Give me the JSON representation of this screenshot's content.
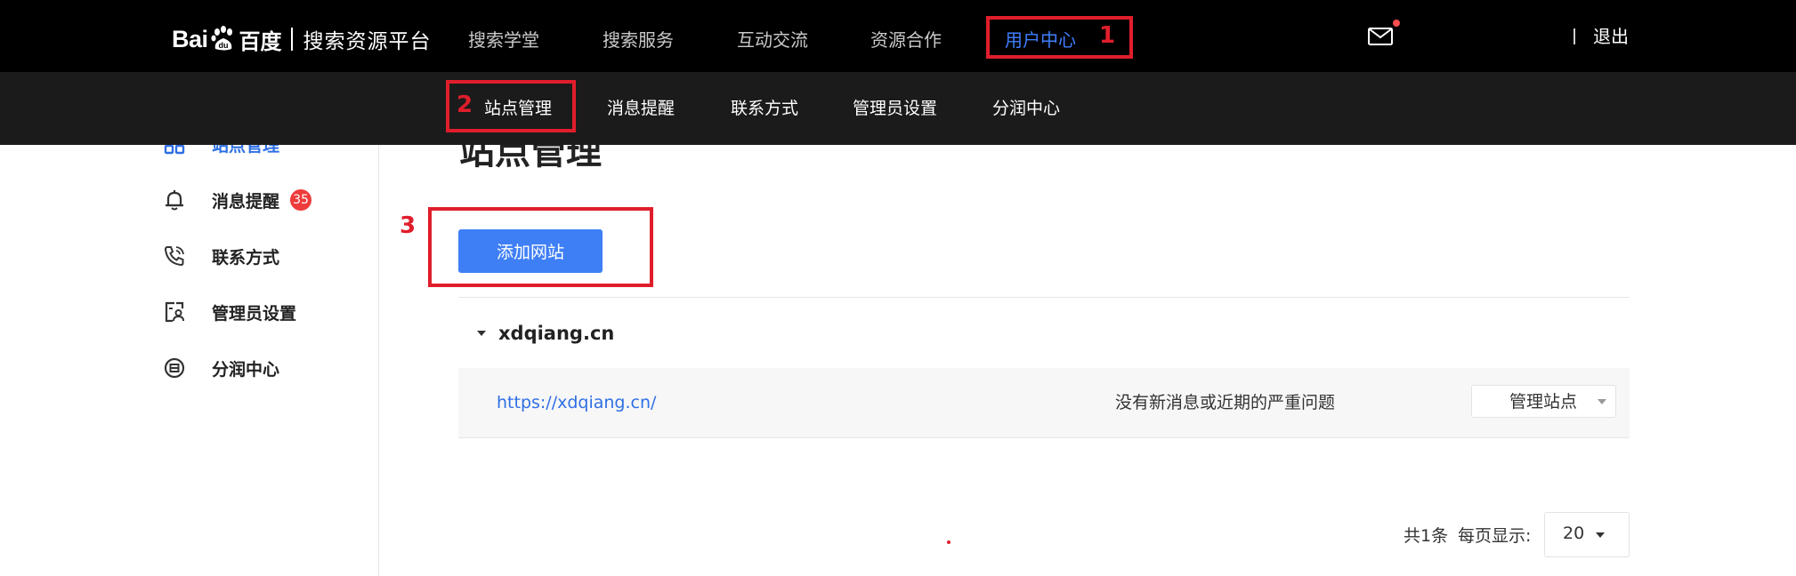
{
  "brand": {
    "logo_text": "Bai",
    "logo_mark_text": "du",
    "logo_cn": "百度",
    "platform": "搜索资源平台"
  },
  "topnav": {
    "items": [
      {
        "label": "搜索学堂"
      },
      {
        "label": "搜索服务"
      },
      {
        "label": "互动交流"
      },
      {
        "label": "资源合作"
      },
      {
        "label": "用户中心",
        "active": true
      }
    ],
    "logout_label": "退出",
    "mail_icon": "mail-icon"
  },
  "subnav": {
    "items": [
      {
        "label": "站点管理",
        "active": true
      },
      {
        "label": "消息提醒"
      },
      {
        "label": "联系方式"
      },
      {
        "label": "管理员设置"
      },
      {
        "label": "分润中心"
      }
    ]
  },
  "annotations": {
    "numbers": [
      "1",
      "2",
      "3"
    ],
    "color": "#e01e2b"
  },
  "sidebar": {
    "items": [
      {
        "label": "站点管理",
        "icon": "site-grid-icon",
        "active": true
      },
      {
        "label": "消息提醒",
        "icon": "bell-icon",
        "badge": "35"
      },
      {
        "label": "联系方式",
        "icon": "phone-icon"
      },
      {
        "label": "管理员设置",
        "icon": "admin-card-icon"
      },
      {
        "label": "分润中心",
        "icon": "coin-icon"
      }
    ]
  },
  "main": {
    "title": "站点管理",
    "add_button": "添加网站",
    "site": {
      "name": "xdqiang.cn",
      "url": "https://xdqiang.cn/",
      "status": "没有新消息或近期的严重问题",
      "manage_label": "管理站点"
    },
    "pager": {
      "total": "共1条",
      "per_page_label": "每页显示:",
      "per_page_value": "20"
    }
  },
  "colors": {
    "accent": "#3f7ff6",
    "link": "#2f6fe4",
    "badge": "#ee3b3b",
    "topbar": "#000000",
    "subbar": "#1b1b1b"
  }
}
